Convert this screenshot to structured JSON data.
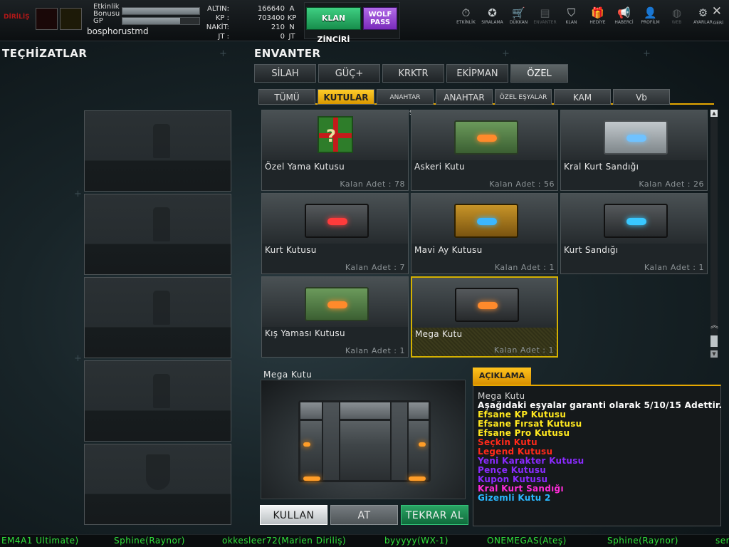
{
  "topbar": {
    "badge_logo_text": "DİRİLİŞ",
    "bonus_label": "Etkinlik\nBonusu",
    "gp_label": "GP",
    "bonus_fill": 1.0,
    "gp_fill": 0.75,
    "player_name": "bosphorustmd",
    "currencies": [
      {
        "label": "ALTIN:",
        "value": "166640",
        "unit": "A"
      },
      {
        "label": "KP :",
        "value": "703400",
        "unit": "KP"
      },
      {
        "label": "NAKİT:",
        "value": "210",
        "unit": "N"
      },
      {
        "label": "JT :",
        "value": "0",
        "unit": "JT"
      }
    ],
    "klan_button": "KLAN ZİNCİRİ",
    "wolf_button": "WOLF\nPASS",
    "nav": [
      {
        "label": "ETKİNLİK",
        "icon": "stopwatch-icon",
        "glyph": "⏱"
      },
      {
        "label": "SIRALAMA",
        "icon": "medal-icon",
        "glyph": "✪"
      },
      {
        "label": "DÜKKAN",
        "icon": "cart-icon",
        "glyph": "🛒"
      },
      {
        "label": "ENVANTER",
        "icon": "inventory-icon",
        "glyph": "▤"
      },
      {
        "label": "KLAN",
        "icon": "shield-icon",
        "glyph": "⛉"
      },
      {
        "label": "HEDİYE",
        "icon": "gift-icon",
        "glyph": "🎁"
      },
      {
        "label": "HABERCİ",
        "icon": "megaphone-icon",
        "glyph": "📢"
      },
      {
        "label": "PROFİLM",
        "icon": "profile-icon",
        "glyph": "👤"
      },
      {
        "label": "WEB",
        "icon": "globe-icon",
        "glyph": "◍"
      },
      {
        "label": "AYARLAR",
        "icon": "gear-icon",
        "glyph": "⚙"
      }
    ],
    "close_glyph": "✕",
    "back_label": "GERİ"
  },
  "left": {
    "title": "TEÇHİZATLAR"
  },
  "inventory": {
    "title": "ENVANTER",
    "tabs": [
      "SİLAH",
      "GÜÇ+",
      "KRKTR",
      "EKİPMAN",
      "ÖZEL"
    ],
    "active_tab": 4,
    "subtabs": [
      "TÜMÜ",
      "KUTULAR",
      "ANAHTAR KUTUSU",
      "ANAHTAR",
      "ÖZEL EŞYALAR",
      "KAM",
      "Vb"
    ],
    "active_subtab": 1,
    "items": [
      {
        "name": "Özel Yama Kutusu",
        "count": "Kalan Adet : 78"
      },
      {
        "name": "Askeri Kutu",
        "count": "Kalan Adet : 56"
      },
      {
        "name": "Kral Kurt Sandığı",
        "count": "Kalan Adet : 26"
      },
      {
        "name": "Kurt Kutusu",
        "count": "Kalan Adet : 7"
      },
      {
        "name": "Mavi Ay Kutusu",
        "count": "Kalan Adet : 1"
      },
      {
        "name": "Kurt Sandığı",
        "count": "Kalan Adet : 1"
      },
      {
        "name": "Kış Yaması Kutusu",
        "count": "Kalan Adet : 1"
      },
      {
        "name": "Mega Kutu",
        "count": "Kalan Adet : 1"
      }
    ],
    "selected_item": 7
  },
  "details": {
    "title": "Mega Kutu",
    "desc_tab": "AÇIKLAMA",
    "lines": [
      {
        "text": "Mega Kutu",
        "color": "#d4d4d4"
      },
      {
        "text": "Aşağıdaki eşyalar garanti olarak 5/10/15 Adettir.",
        "color": "#ffffff"
      },
      {
        "text": "Efsane KP Kutusu",
        "color": "#ffe81f"
      },
      {
        "text": "Efsane Fırsat Kutusu",
        "color": "#ffe81f"
      },
      {
        "text": "Efsane Pro Kutusu",
        "color": "#ffe81f"
      },
      {
        "text": "Seçkin Kutu",
        "color": "#ff2a1a"
      },
      {
        "text": "Legend Kutusu",
        "color": "#ff2a1a"
      },
      {
        "text": "Yeni Karakter Kutusu",
        "color": "#8a2bff"
      },
      {
        "text": "Pençe Kutusu",
        "color": "#8a2bff"
      },
      {
        "text": "Kupon Kutusu",
        "color": "#8a2bff"
      },
      {
        "text": "Kral Kurt Sandığı",
        "color": "#ff2bd8"
      },
      {
        "text": "Gizemli Kutu 2",
        "color": "#2ab8ff"
      }
    ],
    "buttons": {
      "use": "KULLAN",
      "drop": "AT",
      "buy_again": "TEKRAR AL"
    }
  },
  "ticker": [
    "EM4A1 Ultimate)",
    "Sphine(Raynor)",
    "okkesleer72(Marien Diriliş)",
    "byyyyy(WX-1)",
    "ONEMEGAS(Ateş)",
    "Sphine(Raynor)",
    "ser"
  ]
}
